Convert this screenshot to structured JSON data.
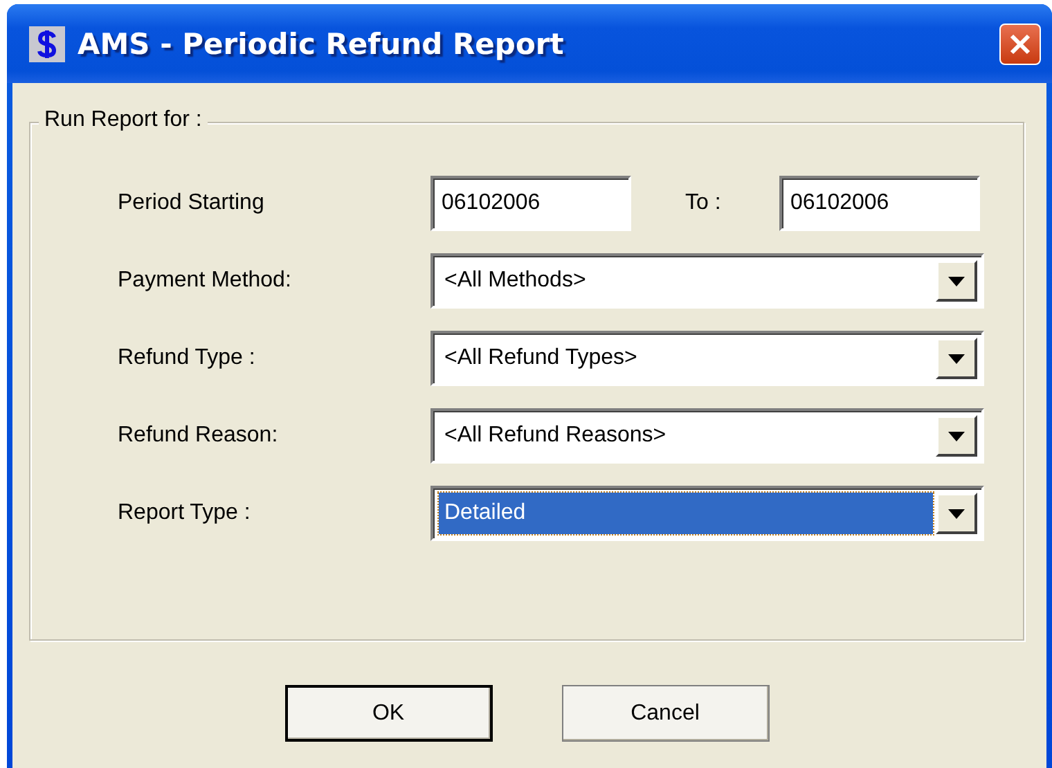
{
  "window": {
    "title": "AMS - Periodic Refund Report"
  },
  "group": {
    "legend": "Run Report for :"
  },
  "period": {
    "label": "Period Starting",
    "start": "06102006",
    "to_label": "To :",
    "end": "06102006"
  },
  "dropdowns": [
    {
      "label": "Payment Method:",
      "value": "<All Methods>",
      "focused": false
    },
    {
      "label": "Refund Type :",
      "value": "<All Refund Types>",
      "focused": false
    },
    {
      "label": "Refund Reason:",
      "value": "<All Refund Reasons>",
      "focused": false
    },
    {
      "label": "Report Type :",
      "value": "Detailed",
      "focused": true
    }
  ],
  "buttons": [
    {
      "label": "OK",
      "default": true
    },
    {
      "label": "Cancel",
      "default": false
    }
  ]
}
